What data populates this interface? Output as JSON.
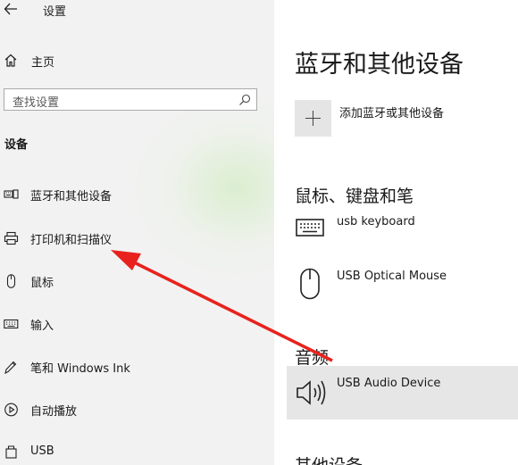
{
  "window": {
    "title": "设置"
  },
  "nav": {
    "home_label": "主页",
    "search_placeholder": "查找设置",
    "section_label": "设备",
    "items": [
      {
        "label": "蓝牙和其他设备",
        "icon": "bluetooth-devices-icon"
      },
      {
        "label": "打印机和扫描仪",
        "icon": "printer-icon"
      },
      {
        "label": "鼠标",
        "icon": "mouse-icon"
      },
      {
        "label": "输入",
        "icon": "keyboard-icon"
      },
      {
        "label": "笔和 Windows Ink",
        "icon": "pen-icon"
      },
      {
        "label": "自动播放",
        "icon": "autoplay-icon"
      },
      {
        "label": "USB",
        "icon": "usb-icon"
      }
    ]
  },
  "main": {
    "title": "蓝牙和其他设备",
    "add_label": "添加蓝牙或其他设备",
    "sections": [
      {
        "title": "鼠标、键盘和笔",
        "devices": [
          {
            "name": "usb keyboard",
            "icon": "keyboard-icon"
          },
          {
            "name": "USB Optical Mouse",
            "icon": "mouse-icon"
          }
        ]
      },
      {
        "title": "音频",
        "devices": [
          {
            "name": "USB Audio Device",
            "icon": "speaker-icon"
          }
        ]
      },
      {
        "title": "其他设备",
        "devices": []
      }
    ]
  },
  "annotation": {
    "color": "#e8231e"
  }
}
